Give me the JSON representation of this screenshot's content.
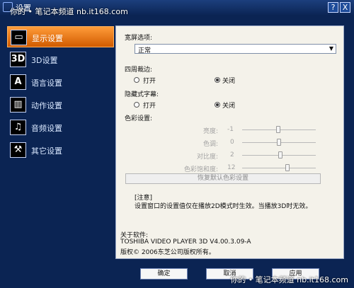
{
  "window": {
    "title": "设置",
    "watermark_top": "你的 • 笔记本频道  nb.it168.com",
    "watermark_bottom": "你的 • 笔记本频道  nb.it168.com",
    "help_label": "?",
    "close_label": "X"
  },
  "sidebar": {
    "items": [
      {
        "label": "显示设置",
        "icon": "display-icon"
      },
      {
        "label": "3D设置",
        "icon": "3d-icon"
      },
      {
        "label": "语言设置",
        "icon": "language-icon"
      },
      {
        "label": "动作设置",
        "icon": "film-icon"
      },
      {
        "label": "音频设置",
        "icon": "music-note-icon"
      },
      {
        "label": "其它设置",
        "icon": "wrench-icon"
      }
    ],
    "icon_text": [
      "",
      "3D",
      "A",
      "",
      "",
      ""
    ]
  },
  "panel": {
    "widescreen_label": "宽屏选项:",
    "widescreen_value": "正常",
    "crop_label": "四周裁边:",
    "crop_on": "打开",
    "crop_off": "关闭",
    "subtitle_label": "隐藏式字幕:",
    "subtitle_on": "打开",
    "subtitle_off": "关闭",
    "color_label": "色彩设置:",
    "sliders": [
      {
        "label": "亮度:",
        "value": "-1"
      },
      {
        "label": "色调:",
        "value": "0"
      },
      {
        "label": "对比度:",
        "value": "2"
      },
      {
        "label": "色彩饱和度:",
        "value": "12"
      }
    ],
    "restore_label": "恢复默认色彩设置",
    "note_title": "[注意]",
    "note_text": "设置窗口的设置值仅在播放2D模式时生效。当播放3D时无效。",
    "about_label": "关于软件:",
    "about_product": "TOSHIBA VIDEO PLAYER 3D  V4.00.3.09-A",
    "about_copyright": "版权© 2006东芝公司版权所有。"
  },
  "footer": {
    "ok_label": "确定",
    "cancel_label": "取消",
    "apply_label": "应用"
  }
}
